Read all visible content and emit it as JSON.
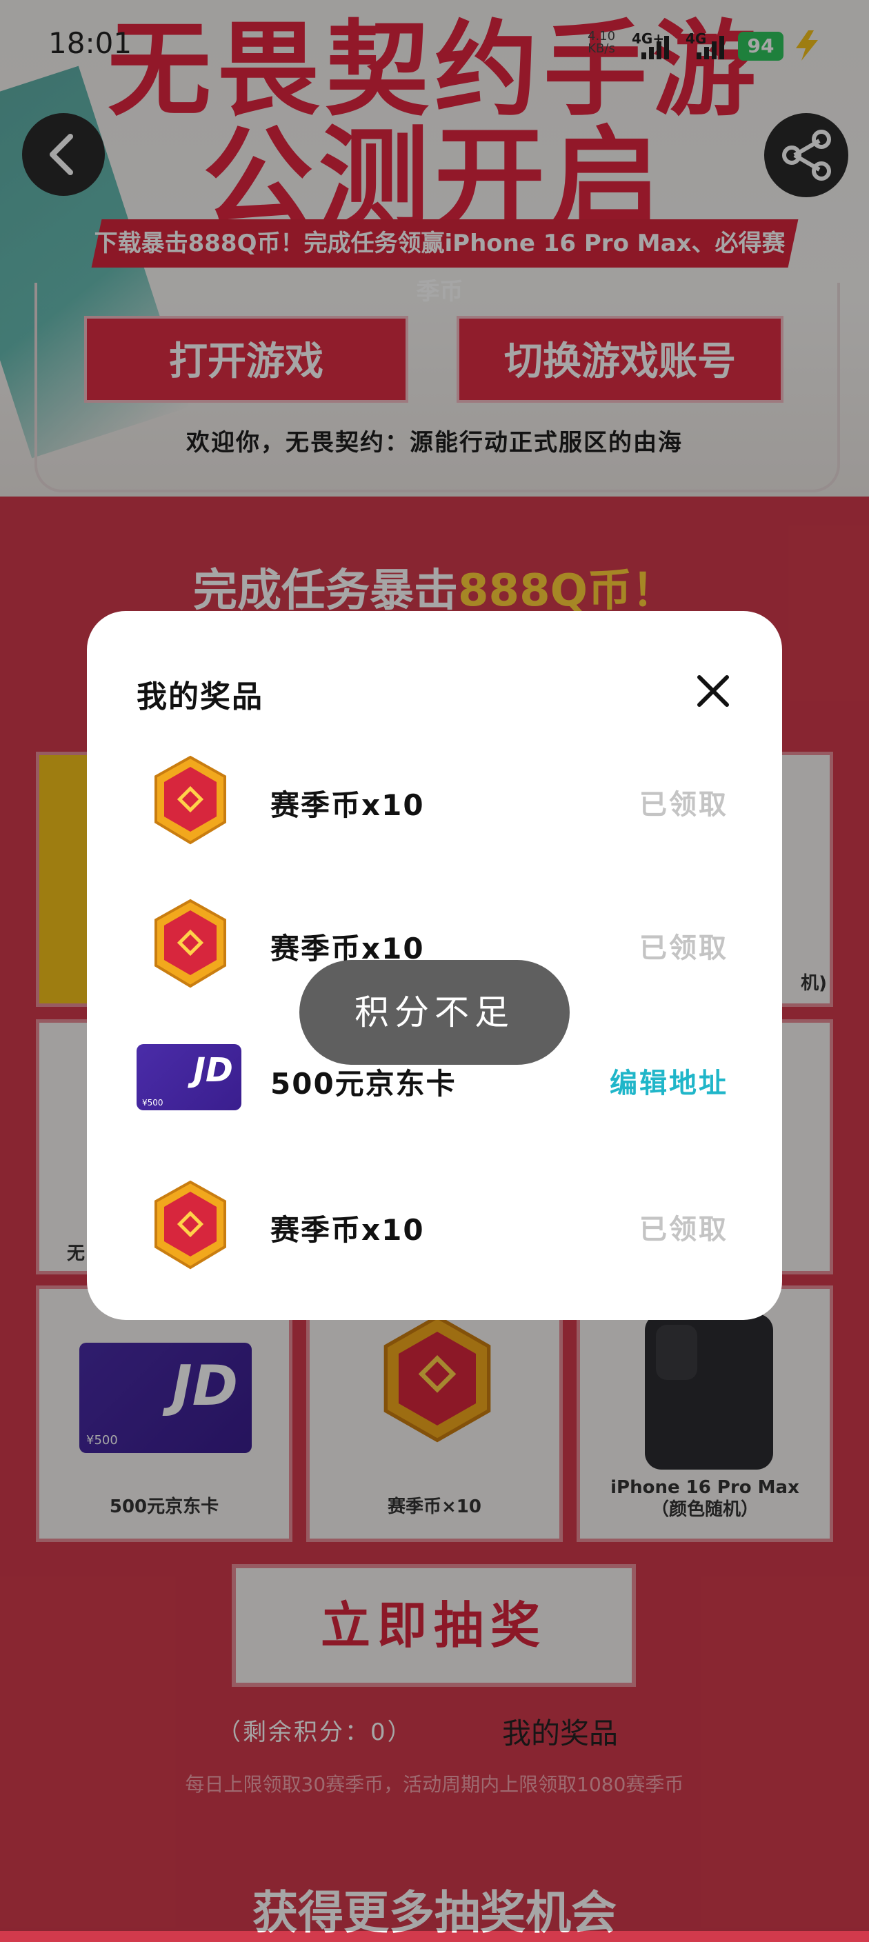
{
  "status_bar": {
    "time": "18:01",
    "net_speed": "4.10",
    "net_unit": "KB/s",
    "sig1": "4G+",
    "sig2": "4G",
    "battery": "94"
  },
  "hero": {
    "title_line1": "无畏契约手游",
    "title_line2": "公测开启",
    "ribbon": "下载暴击888Q币！完成任务领赢iPhone 16 Pro Max、必得赛季币",
    "open_game": "打开游戏",
    "switch_account": "切换游戏账号",
    "welcome": "欢迎你，无畏契约：源能行动正式服区的由海"
  },
  "section": {
    "title_a": "完成任务暴击",
    "title_b": "888Q币！"
  },
  "grid": {
    "items": [
      {
        "label": "500元京东卡",
        "card_value": "¥500",
        "card_brand": "JD"
      },
      {
        "label": "赛季币×10"
      },
      {
        "label_line1": "iPhone 16 Pro Max",
        "label_line2": "（颜色随机）"
      }
    ],
    "peek_left": "无",
    "peek_right": "机)"
  },
  "draw_button": "立即抽奖",
  "remaining": "（剩余积分：0）",
  "my_prizes_link": "我的奖品",
  "rule_text": "每日上限领取30赛季币，活动周期内上限领取1080赛季币",
  "more_title": "获得更多抽奖机会",
  "modal": {
    "title": "我的奖品",
    "items": [
      {
        "name": "赛季币x10",
        "status": "已领取",
        "icon": "season-coin-icon"
      },
      {
        "name": "赛季币x10",
        "status": "已领取",
        "icon": "season-coin-icon"
      },
      {
        "name": "500元京东卡",
        "status": "编辑地址",
        "icon": "jd-card-icon",
        "card_value": "¥500",
        "card_brand": "JD"
      },
      {
        "name": "赛季币x10",
        "status": "已领取",
        "icon": "season-coin-icon"
      }
    ]
  },
  "toast": "积分不足",
  "colors": {
    "brand_red": "#d7263d",
    "action_teal": "#20b6c9",
    "claimed_gray": "#c4c4c4",
    "battery_green": "#2ec55c"
  }
}
